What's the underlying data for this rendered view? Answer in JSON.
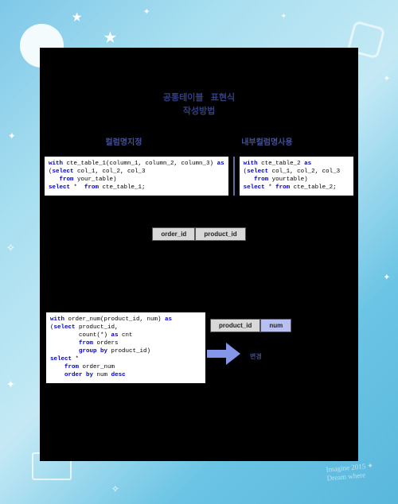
{
  "title": {
    "line1_a": "공통테이블",
    "line1_b": "표현식",
    "line2": "작성방법"
  },
  "sections": {
    "left": "컬럼명지정",
    "right": "내부컬럼명사용"
  },
  "code_left": {
    "l1a": "with",
    "l1b": " cte_table_1(column_1, column_2, column_3) ",
    "l1c": "as",
    "l2a": "(",
    "l2b": "select",
    "l2c": " col_1, col_2, col_3",
    "l3a": "   ",
    "l3b": "from",
    "l3c": " your_table)",
    "l4a": "select",
    "l4b": " * ",
    "l4c": " from",
    "l4d": " cte_table_1;"
  },
  "code_right": {
    "l1a": "with",
    "l1b": " cte_table_2 ",
    "l1c": "as",
    "l2a": "(",
    "l2b": "select",
    "l2c": " col_1, col_2, col_3",
    "l3a": "   ",
    "l3b": "from",
    "l3c": " yourtable)",
    "l4a": "select",
    "l4b": " * ",
    "l4c": "from",
    "l4d": " cte_table_2;"
  },
  "table_mid": {
    "c1": "order_id",
    "c2": "product_id"
  },
  "code_bottom": {
    "l1a": "with",
    "l1b": " order_num(product_id, num) ",
    "l1c": "as",
    "l2a": "(",
    "l2b": "select",
    "l2c": " product_id,",
    "l3a": "        count(*) ",
    "l3b": "as",
    "l3c": " cnt",
    "l4a": "        ",
    "l4b": "from",
    "l4c": " orders",
    "l5a": "        ",
    "l5b": "group",
    "l5c": " by",
    "l5d": " product_id)",
    "l6a": "select",
    "l6b": " *",
    "l7a": "    ",
    "l7b": "from",
    "l7c": " order_num",
    "l8a": "    ",
    "l8b": "order",
    "l8c": " by",
    "l8d": " num ",
    "l8e": "desc"
  },
  "table_right": {
    "c1": "product_id",
    "c2": "num"
  },
  "arrow_label": "변경"
}
